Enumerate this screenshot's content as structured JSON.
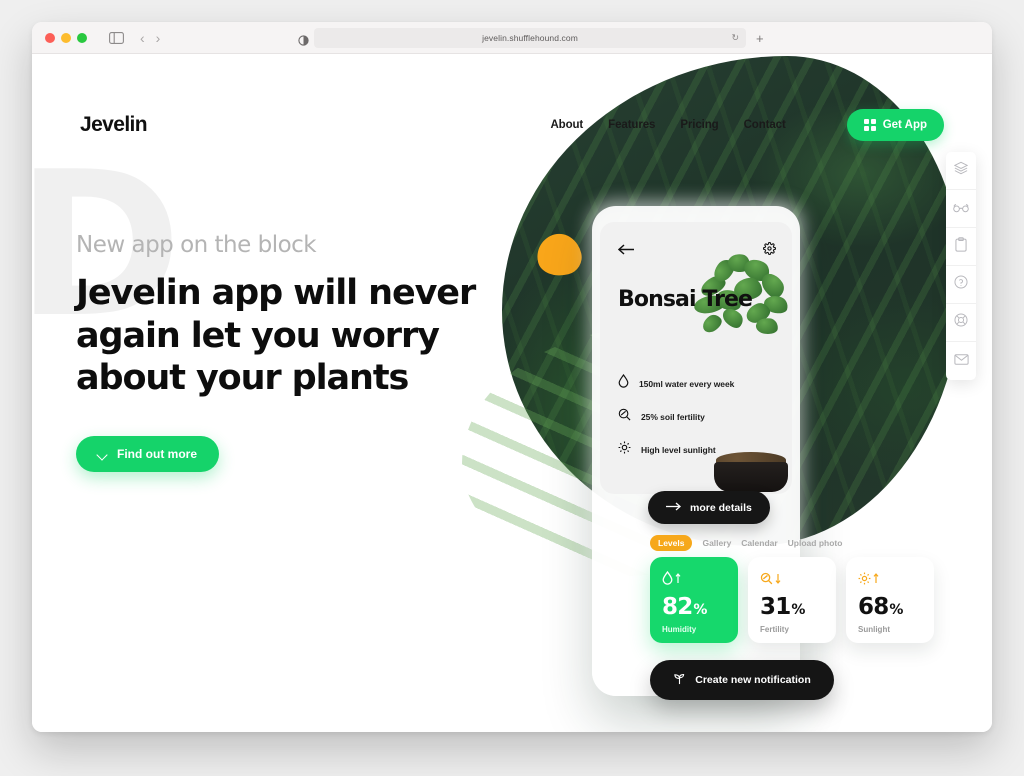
{
  "browser": {
    "url": "jevelin.shufflehound.com",
    "back_label": "‹",
    "forward_label": "›",
    "reload_label": "↻",
    "new_tab_label": "+"
  },
  "site": {
    "logo": "Jevelin",
    "nav": [
      {
        "label": "About"
      },
      {
        "label": "Features"
      },
      {
        "label": "Pricing"
      },
      {
        "label": "Contact"
      }
    ],
    "cta_button": "Get App"
  },
  "hero": {
    "eyebrow": "New app on the block",
    "headline": "Jevelin app will never again let you worry about your plants",
    "button": "Find out more",
    "ghost_letter": "D"
  },
  "phone_app": {
    "title": "Bonsai Tree",
    "details": [
      {
        "icon": "water-drop-icon",
        "text": "150ml water every week"
      },
      {
        "icon": "soil-fertility-icon",
        "text": "25% soil fertility"
      },
      {
        "icon": "sun-icon",
        "text": "High level sunlight"
      }
    ],
    "more_details_button": "more details",
    "tabs": [
      {
        "label": "Levels",
        "active": true
      },
      {
        "label": "Gallery",
        "active": false
      },
      {
        "label": "Calendar",
        "active": false
      },
      {
        "label": "Upload photo",
        "active": false
      }
    ],
    "stats": [
      {
        "value": "82",
        "unit": "%",
        "label": "Humidity",
        "icon": "water-drop-up-icon",
        "highlight": true
      },
      {
        "value": "31",
        "unit": "%",
        "label": "Fertility",
        "icon": "fertility-down-icon",
        "highlight": false
      },
      {
        "value": "68",
        "unit": "%",
        "label": "Sunlight",
        "icon": "sun-up-icon",
        "highlight": false
      }
    ],
    "notification_button": "Create new notification"
  },
  "right_rail": [
    {
      "name": "layers-icon"
    },
    {
      "name": "glasses-icon"
    },
    {
      "name": "clipboard-icon"
    },
    {
      "name": "question-circle-icon"
    },
    {
      "name": "lifebuoy-icon"
    },
    {
      "name": "envelope-icon"
    }
  ],
  "colors": {
    "accent_green": "#15d36a",
    "accent_orange": "#f7a81b",
    "dark": "#151515",
    "muted": "#b4b4b4"
  }
}
